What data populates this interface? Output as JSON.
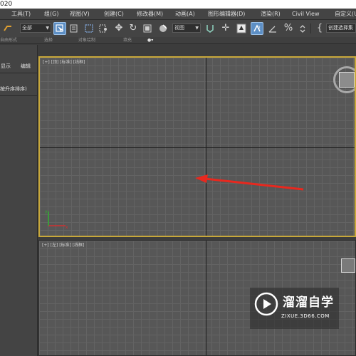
{
  "window": {
    "title_fragment": "020"
  },
  "menubar": {
    "items": [
      "工具(T)",
      "组(G)",
      "视图(V)",
      "创建(C)",
      "修改器(M)",
      "动画(A)",
      "图形编辑器(D)",
      "渲染(R)",
      "Civil View",
      "自定义(U)"
    ]
  },
  "toolbar": {
    "selection_filter": "全部",
    "reference_coordinate": "视图",
    "named_selection_label": "创建选择集"
  },
  "ribbon": {
    "labels": [
      "自由形式",
      "选择",
      "对象绘制",
      "填充"
    ]
  },
  "left_panel": {
    "tab_display": "显示",
    "tab_edit": "编辑",
    "sort_label": "按升序排序)"
  },
  "viewports": {
    "top_label": "[+] [顶] [标准] [线框]",
    "left_label": "[+] [左] [标准] [线框]"
  },
  "annotation": {
    "arrow_color": "#e8281e"
  },
  "accent_colors": {
    "active_viewport_border": "#c8a83a",
    "active_tool": "#5d8fc5"
  },
  "watermark": {
    "title": "溜溜自学",
    "url": "ZIXUE.3D66.COM"
  }
}
